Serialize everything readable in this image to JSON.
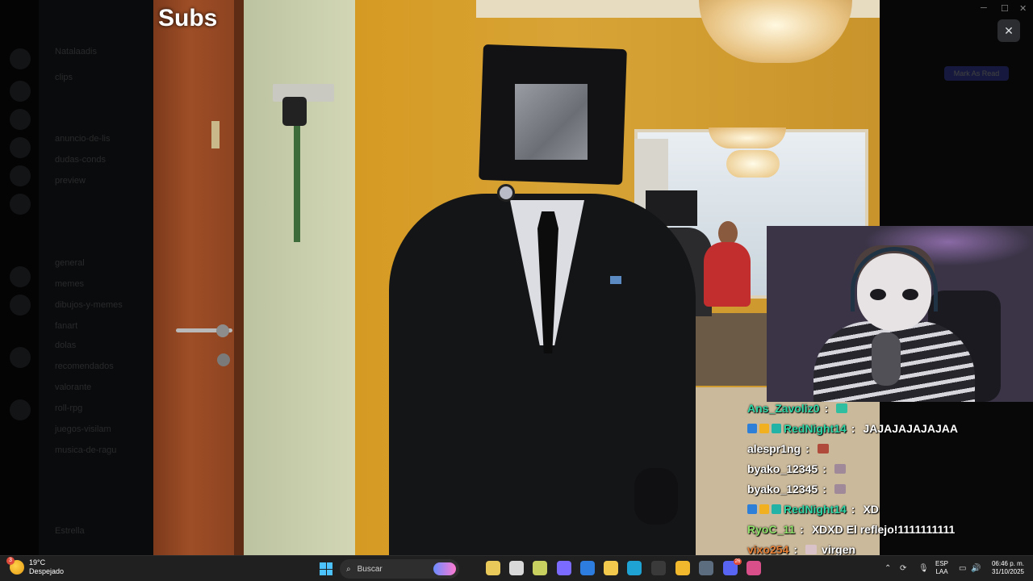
{
  "video": {
    "overlay_text": "Subs"
  },
  "close_button": {
    "glyph": "✕"
  },
  "background_app": {
    "channels": [
      "Natalaadis",
      "clips",
      "anuncio-de-lis",
      "dudas-conds",
      "preview",
      "general",
      "memes",
      "dibujos-y-memes",
      "fanart",
      "dolas",
      "recomendados",
      "valorante",
      "roll-rpg",
      "juegos-visilam",
      "musica-de-ragu",
      "Estrella"
    ],
    "pill_label": "Mark As Read"
  },
  "chat": {
    "messages": [
      {
        "user": "Ans_Zavoliz0",
        "user_color": "#2fd8a6",
        "text": "",
        "emote_color": "#2fbfa0",
        "badges": []
      },
      {
        "user": "RedNight14",
        "user_color": "#2fd8a6",
        "text": "JAJAJAJAJAJAA",
        "emote_color": "",
        "badges": [
          "#2e7fd8",
          "#f0b020",
          "#22b3a6"
        ]
      },
      {
        "user": "alespr1ng",
        "user_color": "#ffffff",
        "text": "",
        "emote_color": "#b04a3a",
        "badges": []
      },
      {
        "user": "byako_12345",
        "user_color": "#ffffff",
        "text": "",
        "emote_color": "#a08a9a",
        "badges": []
      },
      {
        "user": "byako_12345",
        "user_color": "#ffffff",
        "text": "",
        "emote_color": "#a08a9a",
        "badges": []
      },
      {
        "user": "RedNight14",
        "user_color": "#2fd8a6",
        "text": "XD",
        "emote_color": "",
        "badges": [
          "#2e7fd8",
          "#f0b020",
          "#22b3a6"
        ]
      },
      {
        "user": "RyoC_11",
        "user_color": "#8ee06a",
        "text": "XDXD El reflejo!1111111111",
        "emote_color": "",
        "badges": []
      },
      {
        "user": "vixo254",
        "user_color": "#e77f35",
        "text": "virgen",
        "emote_color": "#d9c3c9",
        "badges": []
      }
    ]
  },
  "taskbar": {
    "weather": {
      "temp": "19°C",
      "condition": "Despejado",
      "badge": "3"
    },
    "search_placeholder": "Buscar",
    "apps": [
      {
        "name": "widgets-app-icon",
        "color": "#e8c95a"
      },
      {
        "name": "task-view-icon",
        "color": "#d9d9d9"
      },
      {
        "name": "clock-app-icon",
        "color": "#c8d060"
      },
      {
        "name": "copilot-icon",
        "color": "#7b6cff"
      },
      {
        "name": "store-icon",
        "color": "#2d7de0"
      },
      {
        "name": "file-explorer-icon",
        "color": "#f2c94c"
      },
      {
        "name": "edge-icon",
        "color": "#1fa3d4"
      },
      {
        "name": "terminal-icon",
        "color": "#3a3a3a"
      },
      {
        "name": "chrome-icon",
        "color": "#f1b82d"
      },
      {
        "name": "steam-icon",
        "color": "#5c6d80"
      },
      {
        "name": "discord-icon",
        "color": "#5865f2"
      },
      {
        "name": "app-icon",
        "color": "#d94f8a"
      }
    ],
    "discord_badge": "26",
    "language": {
      "line1": "ESP",
      "line2": "LAA"
    },
    "time": "06:46 p. m.",
    "date": "31/10/2025"
  }
}
